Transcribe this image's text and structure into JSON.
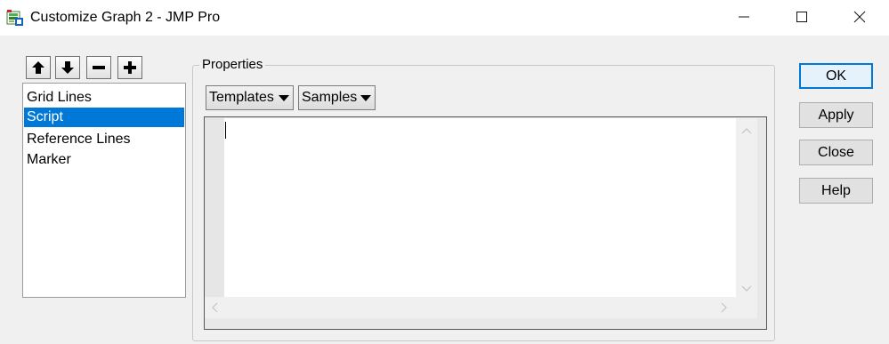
{
  "window": {
    "title": "Customize Graph 2 - JMP Pro",
    "app_icon": "jmp-graph-icon",
    "controls": [
      "minimize-icon",
      "maximize-icon",
      "close-icon"
    ]
  },
  "toolbar": {
    "buttons": [
      {
        "name": "move-up",
        "icon": "arrow-up-icon"
      },
      {
        "name": "move-down",
        "icon": "arrow-down-icon"
      },
      {
        "name": "remove",
        "icon": "minus-icon"
      },
      {
        "name": "add",
        "icon": "plus-icon"
      }
    ]
  },
  "list": {
    "items": [
      {
        "label": "Grid Lines",
        "selected": false
      },
      {
        "label": "Script",
        "selected": true
      },
      {
        "label": "Reference Lines",
        "selected": false
      },
      {
        "label": "Marker",
        "selected": false
      }
    ]
  },
  "properties": {
    "label": "Properties",
    "templates_label": "Templates",
    "samples_label": "Samples",
    "script_value": ""
  },
  "buttons": {
    "ok": "OK",
    "apply": "Apply",
    "close": "Close",
    "help": "Help"
  },
  "colors": {
    "selection": "#0078d7",
    "default_button_border": "#0078d7",
    "window_bg": "#f0f0f0"
  }
}
